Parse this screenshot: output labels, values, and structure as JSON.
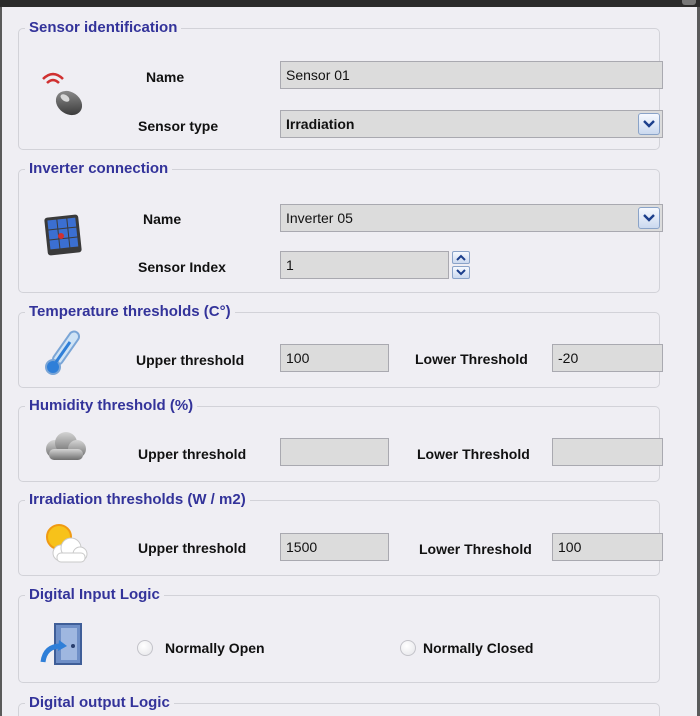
{
  "sensor_identification": {
    "legend": "Sensor identification",
    "name_label": "Name",
    "name_value": "Sensor 01",
    "type_label": "Sensor type",
    "type_value": "Irradiation"
  },
  "inverter_connection": {
    "legend": "Inverter connection",
    "name_label": "Name",
    "name_value": "Inverter 05",
    "index_label": "Sensor Index",
    "index_value": "1"
  },
  "temperature": {
    "legend": "Temperature thresholds (C°)",
    "upper_label": "Upper threshold",
    "upper_value": "100",
    "lower_label": "Lower Threshold",
    "lower_value": "-20"
  },
  "humidity": {
    "legend": "Humidity threshold (%)",
    "upper_label": "Upper threshold",
    "upper_value": "",
    "lower_label": "Lower Threshold",
    "lower_value": ""
  },
  "irradiation": {
    "legend": "Irradiation thresholds (W / m2)",
    "upper_label": "Upper threshold",
    "upper_value": "1500",
    "lower_label": "Lower Threshold",
    "lower_value": "100"
  },
  "digital_input": {
    "legend": "Digital Input Logic",
    "option_open": "Normally Open",
    "option_closed": "Normally Closed"
  },
  "digital_output": {
    "legend": "Digital output Logic"
  },
  "colors": {
    "legend_text": "#33339a",
    "panel_bg": "#efeef3",
    "field_bg": "#dcdcdc"
  },
  "icons": {
    "sensor_identification": "remote-sensor-icon",
    "inverter_connection": "solar-panel-icon",
    "temperature": "thermometer-icon",
    "humidity": "cloud-icon",
    "irradiation": "sun-cloud-icon",
    "digital_input": "door-exit-icon"
  }
}
